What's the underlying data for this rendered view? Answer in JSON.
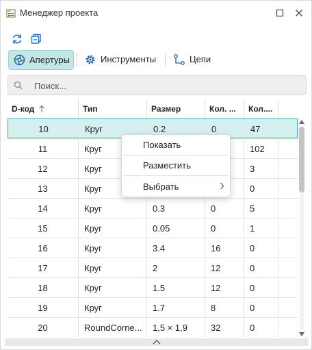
{
  "window": {
    "title": "Менеджер проекта",
    "icons": {
      "app": "project-manager-icon",
      "maximize": "maximize-icon",
      "close": "close-icon"
    }
  },
  "toolbar": {
    "icons": [
      "refresh-icon",
      "collapse-icon"
    ]
  },
  "tabs": [
    {
      "label": "Апертуры",
      "icon": "aperture-icon",
      "active": true
    },
    {
      "label": "Инструменты",
      "icon": "gear-icon",
      "active": false
    },
    {
      "label": "Цепи",
      "icon": "net-icon",
      "active": false
    }
  ],
  "search": {
    "placeholder": "Поиск...",
    "value": ""
  },
  "table": {
    "columns": [
      {
        "label": "D-код",
        "sort": "ascending"
      },
      {
        "label": "Тип"
      },
      {
        "label": "Размер"
      },
      {
        "label": "Кол. ..."
      },
      {
        "label": "Кол...."
      }
    ],
    "rows": [
      [
        "10",
        "Круг",
        "0.2",
        "0",
        "47"
      ],
      [
        "11",
        "Круг",
        "",
        "",
        "102"
      ],
      [
        "12",
        "Круг",
        "",
        "",
        "3"
      ],
      [
        "13",
        "Круг",
        "",
        "",
        "0"
      ],
      [
        "14",
        "Круг",
        "0.3",
        "0",
        "5"
      ],
      [
        "15",
        "Круг",
        "0.05",
        "0",
        "1"
      ],
      [
        "16",
        "Круг",
        "3.4",
        "16",
        "0"
      ],
      [
        "17",
        "Круг",
        "2",
        "12",
        "0"
      ],
      [
        "18",
        "Круг",
        "1.5",
        "12",
        "0"
      ],
      [
        "19",
        "Круг",
        "1.7",
        "8",
        "0"
      ],
      [
        "20",
        "RoundCorne...",
        "1,5 × 1,9",
        "32",
        "0"
      ]
    ],
    "selected_row": 0
  },
  "context_menu": {
    "items": [
      {
        "label": "Показать"
      },
      {
        "label": "Разместить"
      },
      {
        "label": "Выбрать",
        "submenu": true
      }
    ]
  },
  "colors": {
    "accent": "#3ba9a9",
    "active_tab": "#c3e6e6",
    "selected_row": "#d6efef"
  }
}
